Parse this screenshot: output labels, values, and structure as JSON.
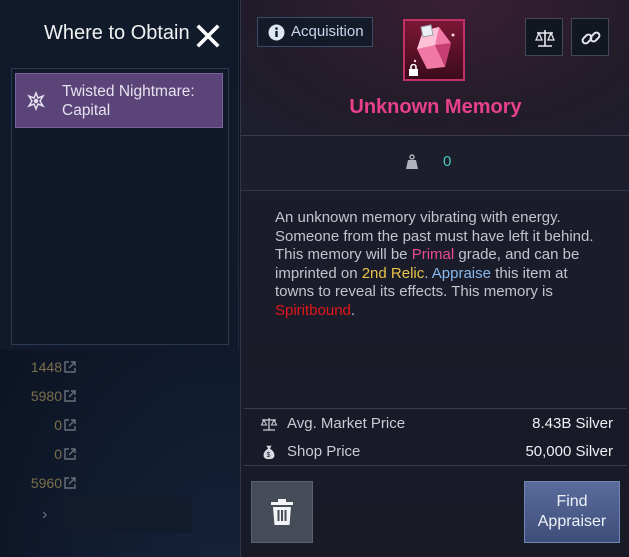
{
  "obtain_panel": {
    "title": "Where to Obtain",
    "sources": [
      {
        "label": "Twisted Nightmare: Capital"
      }
    ]
  },
  "background_list": {
    "values": [
      "1448",
      "5980",
      "0",
      "0",
      "5960"
    ]
  },
  "tooltip": {
    "acquisition_label": "Acquisition",
    "item_name": "Unknown Memory",
    "weight_value": "0",
    "description": {
      "line1": "An unknown memory vibrating with energy. Someone from the past must have left it behind.",
      "p2_a": "This memory will be ",
      "primal": "Primal",
      "p2_b": " grade, and can be imprinted on ",
      "relic": "2nd Relic",
      "p2_c": ". ",
      "appraise": "Appraise",
      "p2_d": " this item at towns to reveal its effects. This memory is ",
      "spiritbound": "Spiritbound",
      "p2_e": "."
    },
    "prices": [
      {
        "label": "Avg. Market Price",
        "value": "8.43B Silver",
        "icon": "scale-icon"
      },
      {
        "label": "Shop Price",
        "value": "50,000 Silver",
        "icon": "money-bag-icon"
      }
    ],
    "find_appraiser": {
      "line1": "Find",
      "line2": "Appraiser"
    }
  },
  "colors": {
    "item_name": "#e8408c",
    "primal": "#e84b8e",
    "relic": "#e9c34a",
    "appraise": "#87b8ef",
    "spiritbound": "#e3161b",
    "weight": "#48c7c0"
  }
}
